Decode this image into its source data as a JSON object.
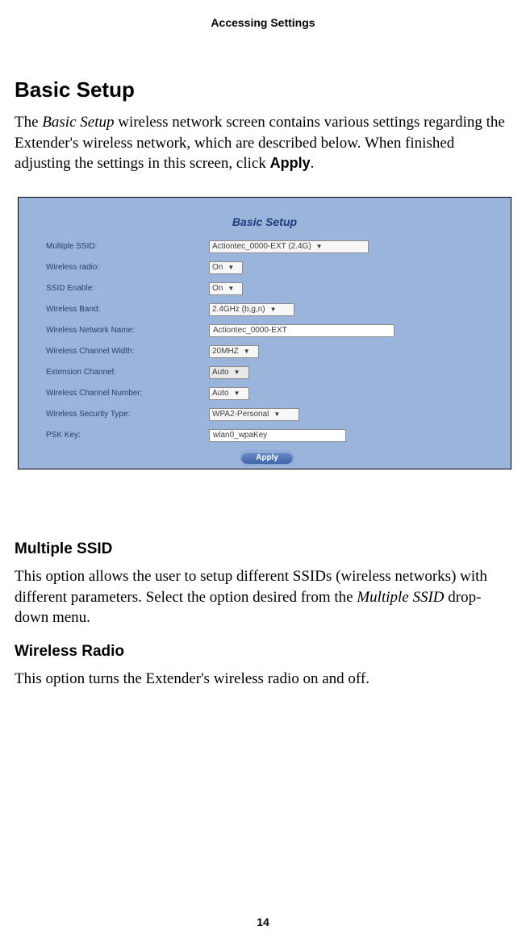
{
  "header": "Accessing Settings",
  "title": "Basic Setup",
  "intro": {
    "pre": "The ",
    "italic": "Basic Setup",
    "mid": " wireless network screen contains various settings regarding the Extender's wireless network, which are described below. When finished adjusting the settings in this screen, click ",
    "bold": "Apply",
    "post": "."
  },
  "panel": {
    "title": "Basic Setup",
    "rows": {
      "multiple_ssid": {
        "label": "Multiple SSID:",
        "value": "Actiontec_0000-EXT (2.4G)"
      },
      "wireless_radio": {
        "label": "Wireless radio:",
        "value": "On"
      },
      "ssid_enable": {
        "label": "SSID Enable:",
        "value": "On"
      },
      "wireless_band": {
        "label": "Wireless Band:",
        "value": "2.4GHz (b,g,n)"
      },
      "network_name": {
        "label": "Wireless Network Name:",
        "value": "Actiontec_0000-EXT"
      },
      "channel_width": {
        "label": "Wireless Channel Width:",
        "value": "20MHZ"
      },
      "ext_channel": {
        "label": "Extension Channel:",
        "value": "Auto"
      },
      "channel_number": {
        "label": "Wireless Channel Number:",
        "value": "Auto"
      },
      "security_type": {
        "label": "Wireless Security Type:",
        "value": "WPA2-Personal"
      },
      "psk_key": {
        "label": "PSK Key:",
        "value": "wlan0_wpaKey"
      }
    },
    "apply": "Apply"
  },
  "sections": {
    "multiple_ssid": {
      "title": "Multiple SSID",
      "text_pre": "This option allows the user to setup different SSIDs (wireless networks) with different parameters. Select the option desired from the ",
      "text_italic": "Multiple SSID",
      "text_post": " drop-down menu."
    },
    "wireless_radio": {
      "title": "Wireless Radio",
      "text": "This option turns the Extender's wireless radio on and off."
    }
  },
  "page_number": "14"
}
